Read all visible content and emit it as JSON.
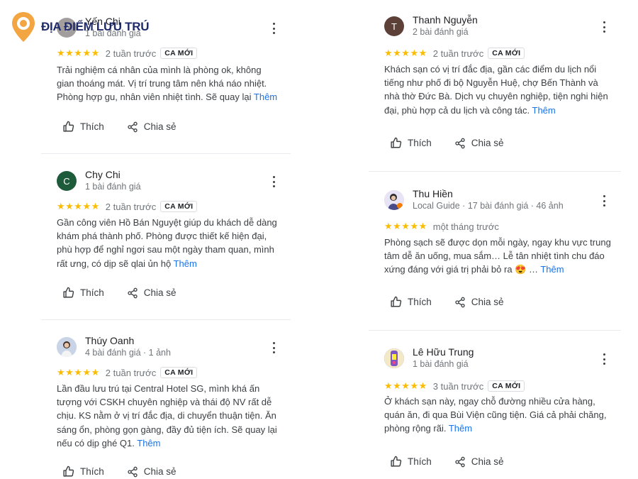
{
  "logo": {
    "text": "ĐỊA ĐIỂM LƯU TRÚ",
    "color": "#f2a541"
  },
  "labels": {
    "like": "Thích",
    "share": "Chia sẻ",
    "more": "Thêm",
    "new_badge": "CA MỚI"
  },
  "left_reviews": [
    {
      "name": "Yến Chi",
      "meta": "1 bài đánh giá",
      "avatar_letter": "Y",
      "avatar_color": "#a39e9e",
      "stars": "★★★★★",
      "when": "2 tuần trước",
      "badge": "CA MỚI",
      "text": "Trải nghiệm cá nhân của mình là phòng ok, không gian thoáng mát. Vị trí trung tâm nên khá náo nhiệt. Phòng hợp gu, nhân viên nhiệt tình. Sẽ quay lại",
      "more_label": "Thêm"
    },
    {
      "name": "Chy Chi",
      "meta": "1 bài đánh giá",
      "avatar_letter": "C",
      "avatar_color": "#1e5b3b",
      "stars": "★★★★★",
      "when": "2 tuần trước",
      "badge": "CA MỚI",
      "text": "Gần công viên Hồ Bán Nguyệt giúp du khách dễ dàng khám phá thành phố. Phòng được thiết kế hiện đại, phù hợp để nghỉ ngơi sau một ngày tham quan, mình rất ưng, có dịp sẽ qlai ủn hộ",
      "more_label": "Thêm"
    },
    {
      "name": "Thúy Oanh",
      "meta": "4 bài đánh giá · 1 ảnh",
      "avatar_letter": "",
      "avatar_color": "#c9d4e6",
      "stars": "★★★★★",
      "when": "2 tuần trước",
      "badge": "CA MỚI",
      "text": "Lần đầu lưu trú tại Central Hotel SG, mình khá ấn tượng với CSKH chuyên nghiệp và thái độ NV rất dễ chịu. KS nằm ở vị trí đắc địa, di chuyển thuận tiện. Ăn sáng ổn, phòng gọn gàng, đầy đủ tiện ích. Sẽ quay lại nếu có dịp ghé Q1.",
      "more_label": "Thêm"
    }
  ],
  "right_reviews": [
    {
      "name": "Thanh Nguyễn",
      "meta": "2 bài đánh giá",
      "avatar_letter": "T",
      "avatar_color": "#5d4037",
      "stars": "★★★★★",
      "when": "2 tuần trước",
      "badge": "CA MỚI",
      "text": "Khách sạn có vị trí đắc địa, gần các điểm du lịch nổi tiếng như phố đi bộ Nguyễn Huệ, chợ Bến Thành và nhà thờ Đức Bà. Dịch vụ chuyên nghiệp, tiện nghi hiện đại, phù hợp cả du lịch và công tác.",
      "more_label": "Thêm"
    },
    {
      "name": "Thu Hiền",
      "meta": "Local Guide · 17 bài đánh giá · 46 ảnh",
      "avatar_letter": "",
      "avatar_color": "#d7ccc8",
      "stars": "★★★★★",
      "when": "một tháng trước",
      "badge": "",
      "text": "Phòng sạch sẽ được dọn mỗi ngày, ngay khu vực trung tâm dễ ăn uống, mua sắm… Lễ tân nhiệt tình chu đáo xứng đáng với giá trị phải bỏ ra 😍 …",
      "more_label": "Thêm"
    },
    {
      "name": "Lê Hữu Trung",
      "meta": "1 bài đánh giá",
      "avatar_letter": "",
      "avatar_color": "#7e57c2",
      "stars": "★★★★★",
      "when": "3 tuần trước",
      "badge": "CA MỚI",
      "text": "Ở khách sạn này, ngay chỗ đường nhiều cửa hàng, quán ăn, đi qua Bùi Viện cũng tiện. Giá cả phải chăng, phòng rộng rãi.",
      "more_label": "Thêm"
    }
  ]
}
